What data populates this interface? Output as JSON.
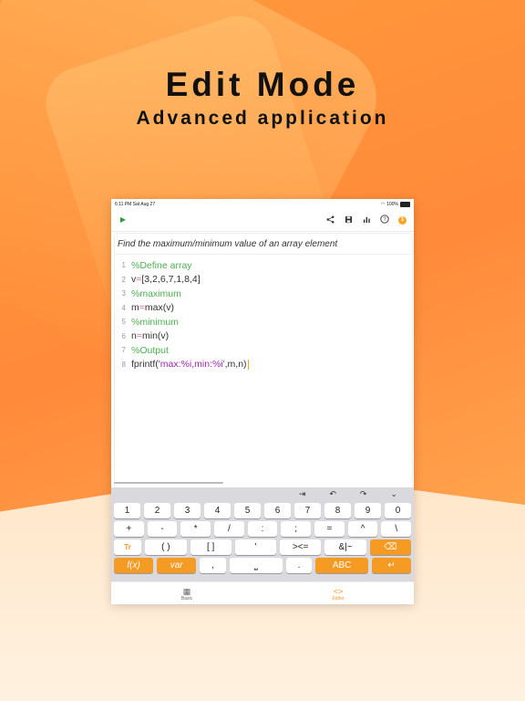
{
  "hero": {
    "title": "Edit Mode",
    "subtitle": "Advanced application"
  },
  "status_bar": {
    "time": "6:11 PM",
    "date": "Sat Aug 27",
    "battery": "100%"
  },
  "toolbar": {
    "run_icon": "▶",
    "share_icon": "share-icon",
    "save_icon": "save-icon",
    "chart_icon": "chart-icon",
    "help_icon": "?",
    "coin_icon": "$"
  },
  "editor": {
    "description": "Find the maximum/minimum value of an array element",
    "lines": [
      {
        "num": "1",
        "text": "%Define array"
      },
      {
        "num": "2",
        "var": "v",
        "op": "=",
        "rest": "[3,2,6,7,1,8,4]"
      },
      {
        "num": "3",
        "text": "%maximum"
      },
      {
        "num": "4",
        "var": "m",
        "op": "=",
        "rest": "max(v)"
      },
      {
        "num": "5",
        "text": "%minimum"
      },
      {
        "num": "6",
        "var": "n",
        "op": "=",
        "rest": "min(v)"
      },
      {
        "num": "7",
        "text": "%Output"
      },
      {
        "num": "8",
        "fn": "fprintf(",
        "str": "'max:%i,min:%i'",
        "rest": ",m,n)"
      }
    ]
  },
  "keyboard": {
    "top_actions": [
      "⇥",
      "↶",
      "↷",
      "⌄"
    ],
    "row_numbers": [
      "1",
      "2",
      "3",
      "4",
      "5",
      "6",
      "7",
      "8",
      "9",
      "0"
    ],
    "row_ops": [
      "+",
      "-",
      "*",
      "/",
      ":",
      ";",
      "=",
      "^",
      "\\"
    ],
    "row3": [
      "Tr",
      "( )",
      "[ ]",
      "'",
      "><=",
      "&|~",
      "⌫"
    ],
    "row4": [
      "f(x)",
      "var",
      ",",
      "⎵",
      ".",
      "ABC",
      "↵"
    ]
  },
  "tabs": [
    {
      "label": "Basic",
      "icon": "▦",
      "active": false
    },
    {
      "label": "Editor",
      "icon": "<>",
      "active": true
    }
  ],
  "colors": {
    "accent": "#f59a23",
    "comment": "#4caf50",
    "operator": "#e0608a",
    "string": "#9c27b0"
  }
}
